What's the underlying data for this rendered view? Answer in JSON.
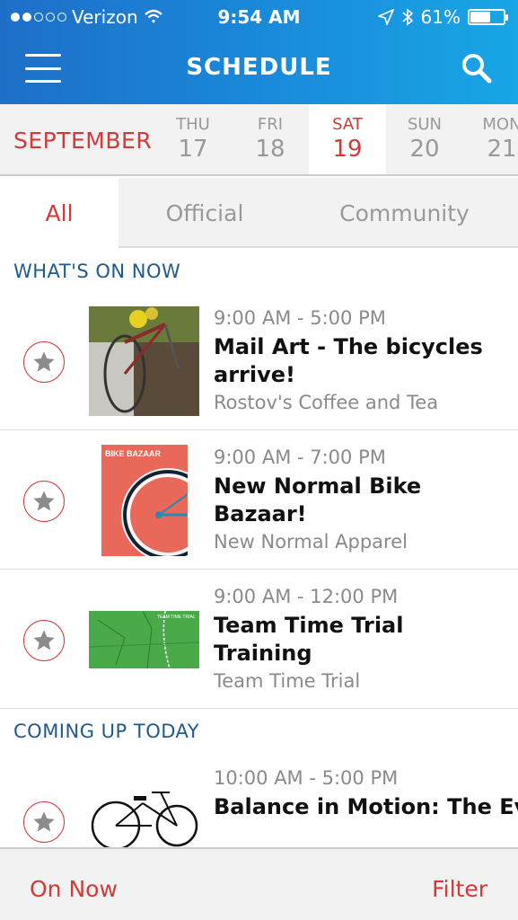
{
  "status_bar": {
    "carrier": "Verizon",
    "time": "9:54 AM",
    "battery": "61%",
    "battery_level": 0.61
  },
  "nav": {
    "title": "SCHEDULE",
    "menu_icon": "hamburger-menu-icon",
    "search_icon": "search-icon"
  },
  "date_bar": {
    "month": "SEPTEMBER",
    "days": [
      {
        "dow": "THU",
        "num": "17"
      },
      {
        "dow": "FRI",
        "num": "18"
      },
      {
        "dow": "SAT",
        "num": "19",
        "selected": true
      },
      {
        "dow": "SUN",
        "num": "20"
      },
      {
        "dow": "MON",
        "num": "21"
      }
    ]
  },
  "tabs": [
    {
      "label": "All",
      "selected": true
    },
    {
      "label": "Official"
    },
    {
      "label": "Community"
    }
  ],
  "sections": {
    "now": "WHAT'S ON NOW",
    "today": "COMING UP TODAY"
  },
  "events": [
    {
      "time": "9:00 AM - 5:00 PM",
      "title": "Mail Art - The bicycles arrive!",
      "venue": "Rostov's Coffee and Tea"
    },
    {
      "time": "9:00 AM - 7:00 PM",
      "title": "New Normal Bike Bazaar!",
      "venue": "New Normal Apparel",
      "poster_text": "BIKE BAZAAR"
    },
    {
      "time": "9:00 AM - 12:00 PM",
      "title": "Team Time Trial Training",
      "venue": "Team Time Trial",
      "map_text": "TEAM TIME TRIAL"
    },
    {
      "time": "10:00 AM - 5:00 PM",
      "title": "Balance in Motion: The Evolution of Cycling i..."
    }
  ],
  "bottom_bar": {
    "on_now": "On Now",
    "filter": "Filter"
  },
  "colors": {
    "accent_red": "#d23a3a",
    "header_blue": "#1a86d8",
    "section_blue": "#1f5a8c"
  }
}
